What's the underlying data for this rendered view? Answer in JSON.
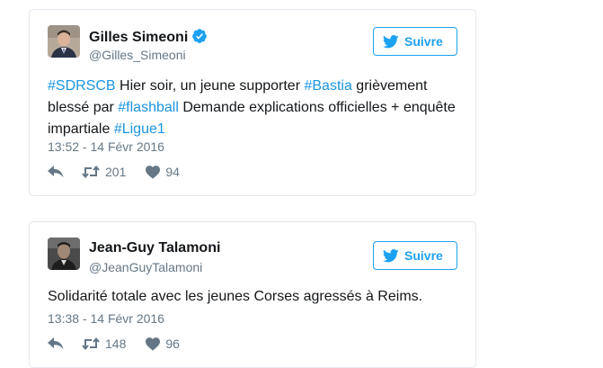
{
  "tweets": [
    {
      "author_name": "Gilles Simeoni",
      "verified": true,
      "handle": "@Gilles_Simeoni",
      "follow_label": "Suivre",
      "text_parts": [
        {
          "text": "#SDRSCB",
          "hashtag": true
        },
        {
          "text": " Hier soir, un jeune supporter ",
          "hashtag": false
        },
        {
          "text": "#Bastia",
          "hashtag": true
        },
        {
          "text": " grièvement blessé par ",
          "hashtag": false
        },
        {
          "text": "#flashball",
          "hashtag": true
        },
        {
          "text": " Demande explications officielles + enquête impartiale ",
          "hashtag": false
        },
        {
          "text": "#Ligue1",
          "hashtag": true
        }
      ],
      "timestamp": "13:52 - 14 Févr 2016",
      "retweets": "201",
      "likes": "94"
    },
    {
      "author_name": "Jean-Guy Talamoni",
      "verified": false,
      "handle": "@JeanGuyTalamoni",
      "follow_label": "Suivre",
      "text_parts": [
        {
          "text": "Solidarité totale avec les jeunes Corses agressés à Reims.",
          "hashtag": false
        }
      ],
      "timestamp": "13:38 - 14 Févr 2016",
      "retweets": "148",
      "likes": "96"
    }
  ],
  "icons": {
    "follow": "twitter-bird-icon",
    "verified": "verified-badge-icon",
    "reply": "reply-icon",
    "retweet": "retweet-icon",
    "like": "heart-icon"
  },
  "colors": {
    "accent": "#1da1f2",
    "hashtag": "#1b95e0",
    "muted": "#657786",
    "border": "#e1e8ed",
    "text": "#14171a"
  }
}
